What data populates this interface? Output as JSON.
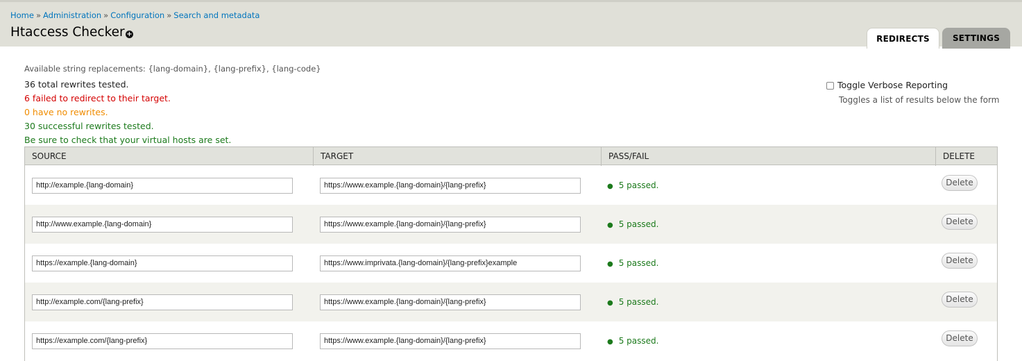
{
  "breadcrumb": {
    "items": [
      "Home",
      "Administration",
      "Configuration",
      "Search and metadata"
    ],
    "separator": "»"
  },
  "page": {
    "title": "Htaccess Checker",
    "shortcut_icon": "+"
  },
  "tabs": [
    {
      "label": "REDIRECTS",
      "active": true
    },
    {
      "label": "SETTINGS",
      "active": false
    }
  ],
  "messages": {
    "replacements": "Available string replacements: {lang-domain}, {lang-prefix}, {lang-code}",
    "total": "36 total rewrites tested.",
    "failed": "6 failed to redirect to their target.",
    "no_rewrites": "0 have no rewrites.",
    "successful": "30 successful rewrites tested.",
    "vhost_note": "Be sure to check that your virtual hosts are set."
  },
  "verbose": {
    "label": "Toggle Verbose Reporting",
    "description": "Toggles a list of results below the form",
    "checked": false
  },
  "table": {
    "headers": [
      "SOURCE",
      "TARGET",
      "PASS/FAIL",
      "DELETE"
    ],
    "rows": [
      {
        "source": "http://example.{lang-domain}",
        "target": "https://www.example.{lang-domain}/{lang-prefix}",
        "result": "5 passed.",
        "delete": "Delete"
      },
      {
        "source": "http://www.example.{lang-domain}",
        "target": "https://www.example.{lang-domain}/{lang-prefix}",
        "result": "5 passed.",
        "delete": "Delete"
      },
      {
        "source": "https://example.{lang-domain}",
        "target": "https://www.imprivata.{lang-domain}/{lang-prefix}example",
        "result": "5 passed.",
        "delete": "Delete"
      },
      {
        "source": "http://example.com/{lang-prefix}",
        "target": "https://www.example.{lang-domain}/{lang-prefix}",
        "result": "5 passed.",
        "delete": "Delete"
      },
      {
        "source": "https://example.com/{lang-prefix}",
        "target": "https://www.example.{lang-domain}/{lang-prefix}",
        "result": "5 passed.",
        "delete": "Delete"
      }
    ]
  },
  "colors": {
    "header_bg": "#e0e0d8",
    "link": "#0074bd",
    "error": "#d40000",
    "warning": "#f08c00",
    "success": "#1c7a1c"
  }
}
